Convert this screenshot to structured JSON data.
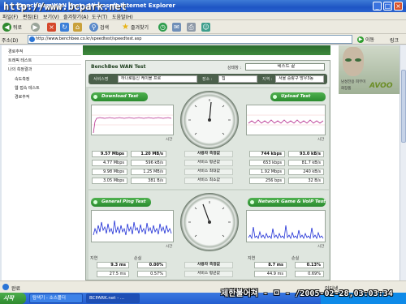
{
  "window": {
    "title": "BenchBee WAN Test - Microsoft Internet Explorer",
    "watermark": "http://www.bcpark.net",
    "buttons": {
      "minimize": "_",
      "maximize": "□",
      "close": "×"
    }
  },
  "menu": [
    "파일(F)",
    "편집(E)",
    "보기(V)",
    "즐겨찾기(A)",
    "도구(T)",
    "도움말(H)"
  ],
  "toolbar": {
    "back_label": "뒤로",
    "search_label": "검색",
    "favorites_label": "즐겨찾기"
  },
  "address": {
    "label": "주소(D)",
    "url": "http://www.benchbee.co.kr/speedtest/speedtest.asp",
    "go_label": "이동",
    "links_label": "링크"
  },
  "site_nav": [
    "경로추적",
    "트래픽 테스트",
    "나의 측정결과",
    "속도측정",
    "웹 접속 테스트",
    "경로추적"
  ],
  "banner": {
    "caption1": "남성전용 피부미",
    "caption2": "화장품",
    "logo": "AVOO"
  },
  "app": {
    "title": "BenchBee WAN Test",
    "status_label": "상태창 :",
    "status_value": "테스트 끝",
    "isp_label": "서비스명",
    "isp_value": "하나로통신 케이블 프로",
    "place_label": "장소 :",
    "place_value": "집",
    "region_label": "지역 :",
    "region_value": "서울 중랑구 망우3동",
    "download": {
      "title": "Download Test",
      "time_label": "시간",
      "rows": [
        {
          "label": "사용자 측정값",
          "mbps": "9.57 Mbps",
          "bytes": "1.20 MB/s"
        },
        {
          "label": "서비스 평균값",
          "mbps": "4.77 Mbps",
          "bytes": "596 kB/s"
        },
        {
          "label": "서비스 최대값",
          "mbps": "9.98 Mbps",
          "bytes": "1.25 MB/s"
        },
        {
          "label": "서비스 최소값",
          "mbps": "3.05 Mbps",
          "bytes": "381 B/s"
        }
      ]
    },
    "upload": {
      "title": "Upload Test",
      "time_label": "시간",
      "rows": [
        {
          "kbps": "744 kbps",
          "bytes": "93.0 kB/s"
        },
        {
          "kbps": "653 kbps",
          "bytes": "81.7 kB/s"
        },
        {
          "kbps": "1.92 Mbps",
          "bytes": "240 kB/s"
        },
        {
          "kbps": "256 bps",
          "bytes": "32 B/s"
        }
      ]
    },
    "ping": {
      "title": "General Ping Test",
      "time_label": "시간",
      "col1": "지연",
      "col2": "손실",
      "rows": [
        {
          "label": "사용자 측정값",
          "ms": "9.3 ms",
          "loss": "0.00%"
        },
        {
          "label": "서비스 평균값",
          "ms": "27.5 ms",
          "loss": "0.57%"
        }
      ]
    },
    "game": {
      "title": "Network Game & VoIP Test",
      "time_label": "시간",
      "col1": "지연",
      "col2": "손실",
      "rows": [
        {
          "ms": "8.7 ms",
          "loss": "0.13%"
        },
        {
          "ms": "44.9 ms",
          "loss": "0.69%"
        }
      ]
    }
  },
  "status_bar": {
    "text": "완료",
    "zone": "인터넷"
  },
  "taskbar": {
    "start": "시작",
    "tasks": [
      "탐색기 - 소스폴더",
      "BCPARK.net - ..."
    ]
  },
  "capture_stamp": "제한불어쳐 - ㅁ - /2005-02-28,03:03:34"
}
